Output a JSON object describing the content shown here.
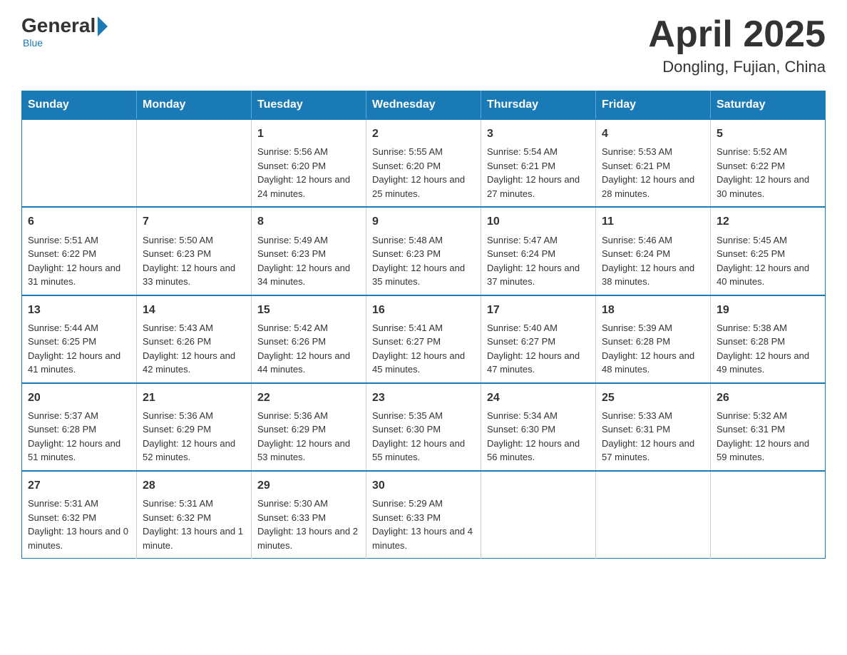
{
  "logo": {
    "general": "General",
    "blue": "Blue",
    "tagline": "Blue"
  },
  "header": {
    "title": "April 2025",
    "location": "Dongling, Fujian, China"
  },
  "days_of_week": [
    "Sunday",
    "Monday",
    "Tuesday",
    "Wednesday",
    "Thursday",
    "Friday",
    "Saturday"
  ],
  "weeks": [
    [
      {
        "day": "",
        "sunrise": "",
        "sunset": "",
        "daylight": ""
      },
      {
        "day": "",
        "sunrise": "",
        "sunset": "",
        "daylight": ""
      },
      {
        "day": "1",
        "sunrise": "Sunrise: 5:56 AM",
        "sunset": "Sunset: 6:20 PM",
        "daylight": "Daylight: 12 hours and 24 minutes."
      },
      {
        "day": "2",
        "sunrise": "Sunrise: 5:55 AM",
        "sunset": "Sunset: 6:20 PM",
        "daylight": "Daylight: 12 hours and 25 minutes."
      },
      {
        "day": "3",
        "sunrise": "Sunrise: 5:54 AM",
        "sunset": "Sunset: 6:21 PM",
        "daylight": "Daylight: 12 hours and 27 minutes."
      },
      {
        "day": "4",
        "sunrise": "Sunrise: 5:53 AM",
        "sunset": "Sunset: 6:21 PM",
        "daylight": "Daylight: 12 hours and 28 minutes."
      },
      {
        "day": "5",
        "sunrise": "Sunrise: 5:52 AM",
        "sunset": "Sunset: 6:22 PM",
        "daylight": "Daylight: 12 hours and 30 minutes."
      }
    ],
    [
      {
        "day": "6",
        "sunrise": "Sunrise: 5:51 AM",
        "sunset": "Sunset: 6:22 PM",
        "daylight": "Daylight: 12 hours and 31 minutes."
      },
      {
        "day": "7",
        "sunrise": "Sunrise: 5:50 AM",
        "sunset": "Sunset: 6:23 PM",
        "daylight": "Daylight: 12 hours and 33 minutes."
      },
      {
        "day": "8",
        "sunrise": "Sunrise: 5:49 AM",
        "sunset": "Sunset: 6:23 PM",
        "daylight": "Daylight: 12 hours and 34 minutes."
      },
      {
        "day": "9",
        "sunrise": "Sunrise: 5:48 AM",
        "sunset": "Sunset: 6:23 PM",
        "daylight": "Daylight: 12 hours and 35 minutes."
      },
      {
        "day": "10",
        "sunrise": "Sunrise: 5:47 AM",
        "sunset": "Sunset: 6:24 PM",
        "daylight": "Daylight: 12 hours and 37 minutes."
      },
      {
        "day": "11",
        "sunrise": "Sunrise: 5:46 AM",
        "sunset": "Sunset: 6:24 PM",
        "daylight": "Daylight: 12 hours and 38 minutes."
      },
      {
        "day": "12",
        "sunrise": "Sunrise: 5:45 AM",
        "sunset": "Sunset: 6:25 PM",
        "daylight": "Daylight: 12 hours and 40 minutes."
      }
    ],
    [
      {
        "day": "13",
        "sunrise": "Sunrise: 5:44 AM",
        "sunset": "Sunset: 6:25 PM",
        "daylight": "Daylight: 12 hours and 41 minutes."
      },
      {
        "day": "14",
        "sunrise": "Sunrise: 5:43 AM",
        "sunset": "Sunset: 6:26 PM",
        "daylight": "Daylight: 12 hours and 42 minutes."
      },
      {
        "day": "15",
        "sunrise": "Sunrise: 5:42 AM",
        "sunset": "Sunset: 6:26 PM",
        "daylight": "Daylight: 12 hours and 44 minutes."
      },
      {
        "day": "16",
        "sunrise": "Sunrise: 5:41 AM",
        "sunset": "Sunset: 6:27 PM",
        "daylight": "Daylight: 12 hours and 45 minutes."
      },
      {
        "day": "17",
        "sunrise": "Sunrise: 5:40 AM",
        "sunset": "Sunset: 6:27 PM",
        "daylight": "Daylight: 12 hours and 47 minutes."
      },
      {
        "day": "18",
        "sunrise": "Sunrise: 5:39 AM",
        "sunset": "Sunset: 6:28 PM",
        "daylight": "Daylight: 12 hours and 48 minutes."
      },
      {
        "day": "19",
        "sunrise": "Sunrise: 5:38 AM",
        "sunset": "Sunset: 6:28 PM",
        "daylight": "Daylight: 12 hours and 49 minutes."
      }
    ],
    [
      {
        "day": "20",
        "sunrise": "Sunrise: 5:37 AM",
        "sunset": "Sunset: 6:28 PM",
        "daylight": "Daylight: 12 hours and 51 minutes."
      },
      {
        "day": "21",
        "sunrise": "Sunrise: 5:36 AM",
        "sunset": "Sunset: 6:29 PM",
        "daylight": "Daylight: 12 hours and 52 minutes."
      },
      {
        "day": "22",
        "sunrise": "Sunrise: 5:36 AM",
        "sunset": "Sunset: 6:29 PM",
        "daylight": "Daylight: 12 hours and 53 minutes."
      },
      {
        "day": "23",
        "sunrise": "Sunrise: 5:35 AM",
        "sunset": "Sunset: 6:30 PM",
        "daylight": "Daylight: 12 hours and 55 minutes."
      },
      {
        "day": "24",
        "sunrise": "Sunrise: 5:34 AM",
        "sunset": "Sunset: 6:30 PM",
        "daylight": "Daylight: 12 hours and 56 minutes."
      },
      {
        "day": "25",
        "sunrise": "Sunrise: 5:33 AM",
        "sunset": "Sunset: 6:31 PM",
        "daylight": "Daylight: 12 hours and 57 minutes."
      },
      {
        "day": "26",
        "sunrise": "Sunrise: 5:32 AM",
        "sunset": "Sunset: 6:31 PM",
        "daylight": "Daylight: 12 hours and 59 minutes."
      }
    ],
    [
      {
        "day": "27",
        "sunrise": "Sunrise: 5:31 AM",
        "sunset": "Sunset: 6:32 PM",
        "daylight": "Daylight: 13 hours and 0 minutes."
      },
      {
        "day": "28",
        "sunrise": "Sunrise: 5:31 AM",
        "sunset": "Sunset: 6:32 PM",
        "daylight": "Daylight: 13 hours and 1 minute."
      },
      {
        "day": "29",
        "sunrise": "Sunrise: 5:30 AM",
        "sunset": "Sunset: 6:33 PM",
        "daylight": "Daylight: 13 hours and 2 minutes."
      },
      {
        "day": "30",
        "sunrise": "Sunrise: 5:29 AM",
        "sunset": "Sunset: 6:33 PM",
        "daylight": "Daylight: 13 hours and 4 minutes."
      },
      {
        "day": "",
        "sunrise": "",
        "sunset": "",
        "daylight": ""
      },
      {
        "day": "",
        "sunrise": "",
        "sunset": "",
        "daylight": ""
      },
      {
        "day": "",
        "sunrise": "",
        "sunset": "",
        "daylight": ""
      }
    ]
  ]
}
